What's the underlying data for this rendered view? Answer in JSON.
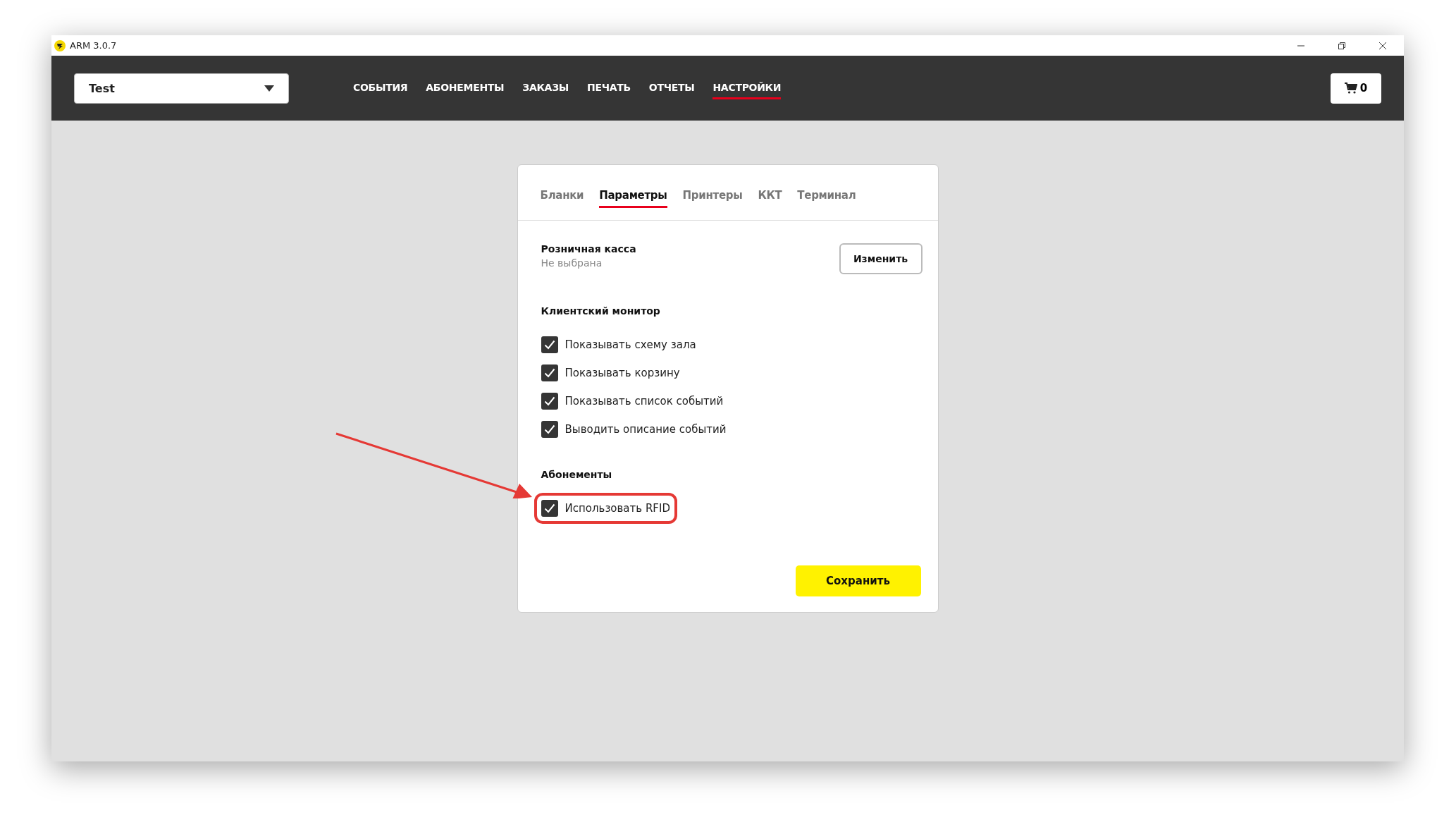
{
  "window": {
    "title": "ARM 3.0.7"
  },
  "venue_select": {
    "value": "Test"
  },
  "nav": [
    {
      "label": "СОБЫТИЯ",
      "selected": false
    },
    {
      "label": "АБОНЕМЕНТЫ",
      "selected": false
    },
    {
      "label": "ЗАКАЗЫ",
      "selected": false
    },
    {
      "label": "ПЕЧАТЬ",
      "selected": false
    },
    {
      "label": "ОТЧЕТЫ",
      "selected": false
    },
    {
      "label": "НАСТРОЙКИ",
      "selected": true
    }
  ],
  "cart": {
    "count": "0"
  },
  "tabs": [
    {
      "label": "Бланки",
      "selected": false
    },
    {
      "label": "Параметры",
      "selected": true
    },
    {
      "label": "Принтеры",
      "selected": false
    },
    {
      "label": "ККТ",
      "selected": false
    },
    {
      "label": "Терминал",
      "selected": false
    }
  ],
  "register": {
    "title": "Розничная касса",
    "value": "Не выбрана",
    "button": "Изменить"
  },
  "sections": [
    {
      "title": "Клиентский монитор",
      "options": [
        {
          "label": "Показывать схему зала",
          "checked": true
        },
        {
          "label": "Показывать корзину",
          "checked": true
        },
        {
          "label": "Показывать список событий",
          "checked": true
        },
        {
          "label": "Выводить описание событий",
          "checked": true
        }
      ]
    },
    {
      "title": "Абонементы",
      "options": [
        {
          "label": "Использовать RFID",
          "checked": true,
          "highlighted": true
        }
      ]
    }
  ],
  "save_button": "Сохранить"
}
